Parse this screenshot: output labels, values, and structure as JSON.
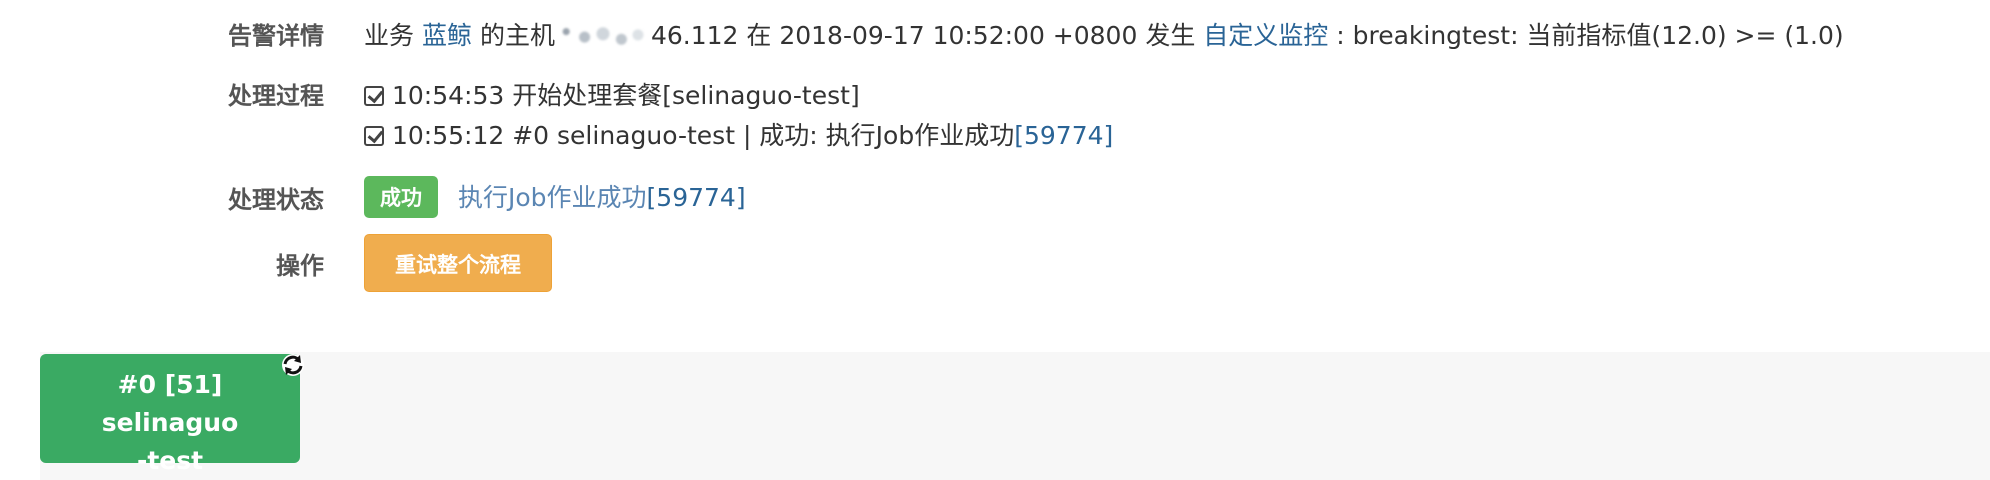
{
  "alert": {
    "label": "告警详情",
    "prefix": "业务",
    "biz_link": "蓝鲸",
    "host_text": "的主机",
    "ip_tail": "46.112",
    "mid_text": "在 2018-09-17 10:52:00 +0800 发生",
    "monitor_link": "自定义监控",
    "suffix": ": breakingtest: 当前指标值(12.0) >= (1.0)"
  },
  "process": {
    "label": "处理过程",
    "steps": [
      {
        "text": "10:54:53 开始处理套餐[selinaguo-test]",
        "link": ""
      },
      {
        "text": "10:55:12 #0 selinaguo-test | 成功: 执行Job作业成功",
        "link": "[59774]"
      }
    ]
  },
  "status": {
    "label": "处理状态",
    "badge": "成功",
    "message": "执行Job作业成功",
    "job_id": "[59774]",
    "badge_color": "#5cb85c"
  },
  "operation": {
    "label": "操作",
    "retry_button": "重试整个流程",
    "button_color": "#f0ad4e"
  },
  "flow": {
    "node_line1": "#0 [51] selinaguo",
    "node_line2": "-test",
    "node_color": "#3aaa63",
    "icon": "refresh-icon"
  }
}
